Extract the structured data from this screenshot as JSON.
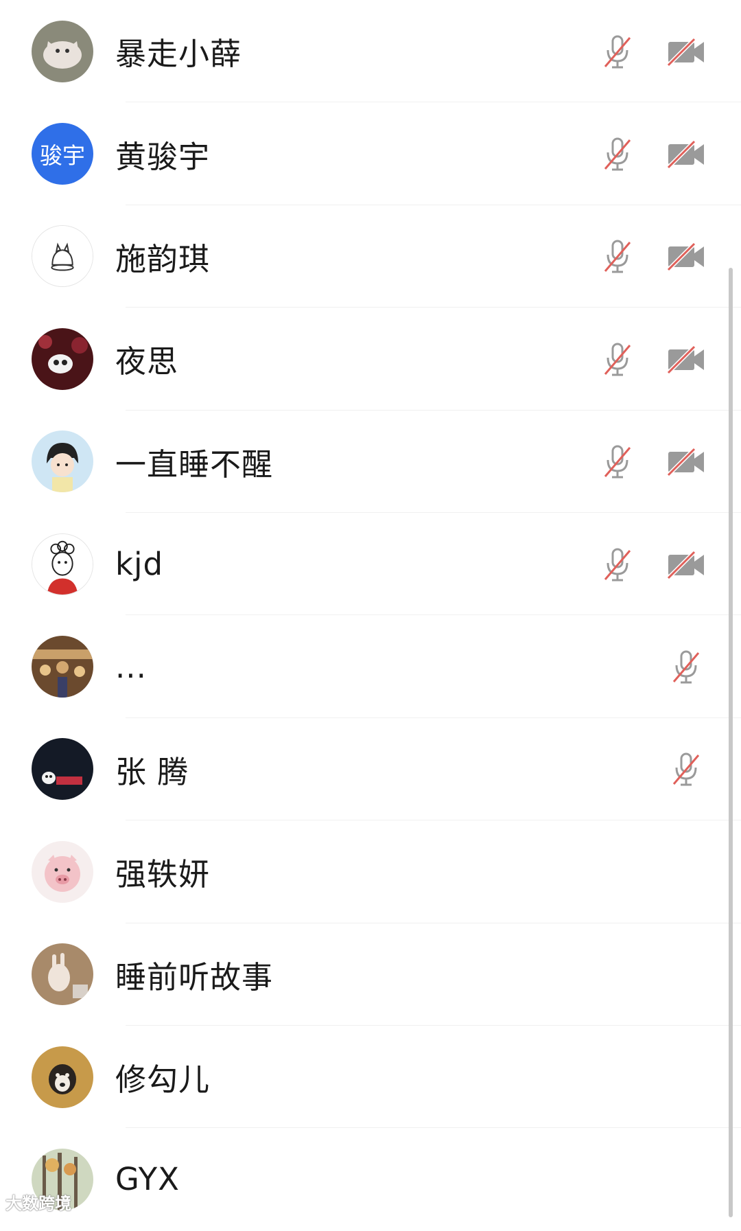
{
  "colors": {
    "muted_stroke": "#9a9a9a",
    "muted_slash": "#e0605a",
    "divider": "#f0f0f0",
    "avatar_blue": "#2f6fe8"
  },
  "participants": [
    {
      "name": "暴走小薛",
      "avatar": "cat-photo-avatar",
      "mic_muted": true,
      "camera_off": true
    },
    {
      "name": "黄骏宇",
      "avatar_text": "骏宇",
      "avatar": "text-avatar",
      "mic_muted": true,
      "camera_off": true
    },
    {
      "name": "施韵琪",
      "avatar": "cat-sketch-avatar",
      "mic_muted": true,
      "camera_off": true
    },
    {
      "name": "夜思",
      "avatar": "panda-red-avatar",
      "mic_muted": true,
      "camera_off": true
    },
    {
      "name": "一直睡不醒",
      "avatar": "cartoon-girl-avatar",
      "mic_muted": true,
      "camera_off": true
    },
    {
      "name": "kjd",
      "avatar": "curly-hair-avatar",
      "mic_muted": true,
      "camera_off": true
    },
    {
      "name": "...",
      "avatar": "market-photo-avatar",
      "mic_muted": true,
      "camera_off": false
    },
    {
      "name": "张 腾",
      "avatar": "panda-night-avatar",
      "mic_muted": true,
      "camera_off": false
    },
    {
      "name": "强轶妍",
      "avatar": "pig-avatar",
      "mic_muted": false,
      "camera_off": false
    },
    {
      "name": "睡前听故事",
      "avatar": "bunny-doll-avatar",
      "mic_muted": false,
      "camera_off": false
    },
    {
      "name": "修勾儿",
      "avatar": "dog-avatar",
      "mic_muted": false,
      "camera_off": false
    },
    {
      "name": "GYX",
      "avatar": "forest-avatar",
      "mic_muted": false,
      "camera_off": false
    }
  ],
  "watermark": "大数跨境"
}
